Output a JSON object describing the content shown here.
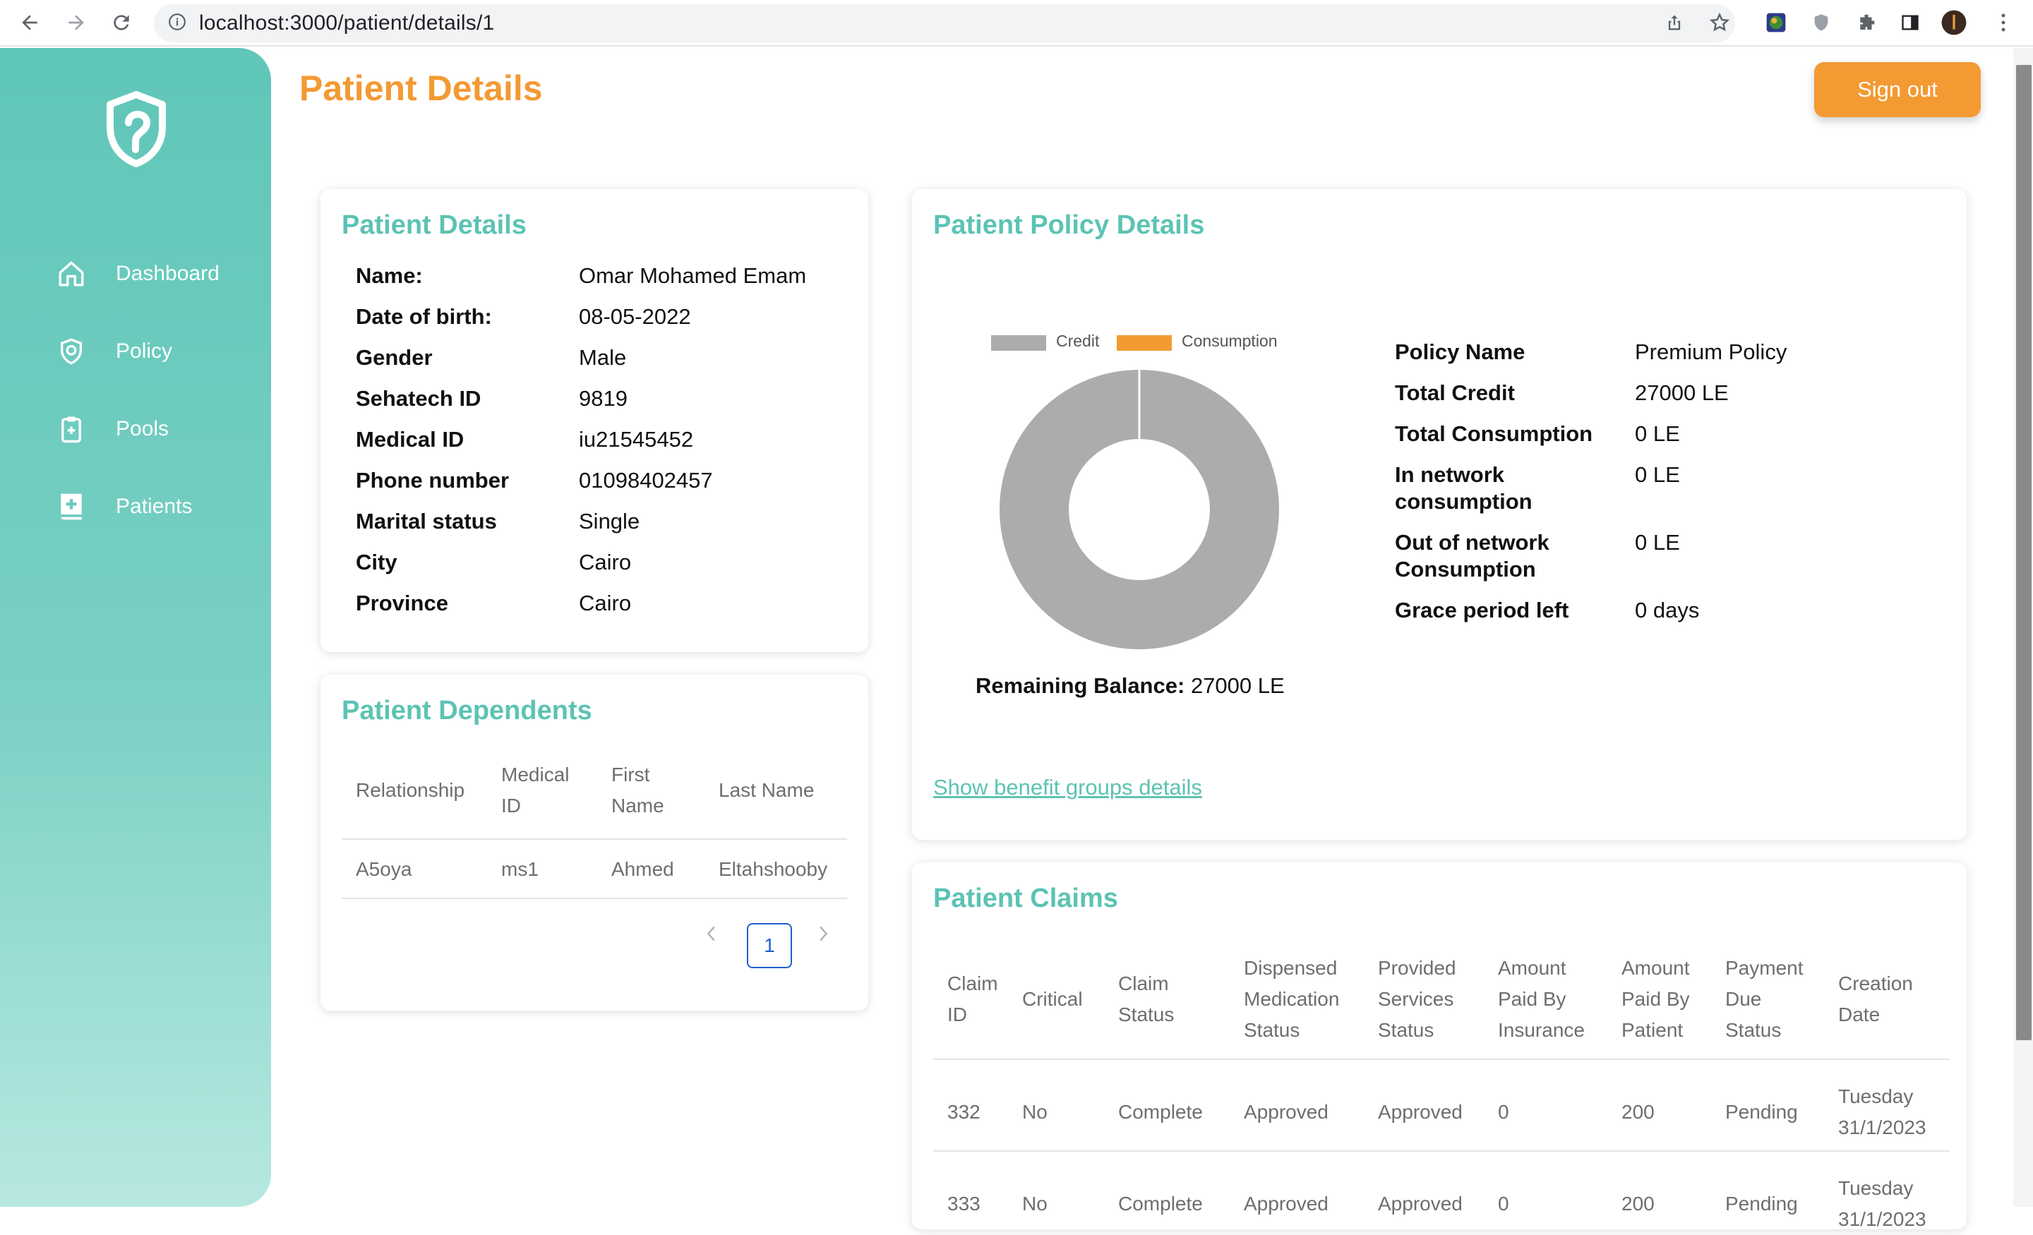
{
  "browser": {
    "url": "localhost:3000/patient/details/1"
  },
  "sidebar": {
    "items": [
      {
        "label": "Dashboard",
        "icon": "home-icon"
      },
      {
        "label": "Policy",
        "icon": "shield-icon"
      },
      {
        "label": "Pools",
        "icon": "clipboard-icon"
      },
      {
        "label": "Patients",
        "icon": "medical-book-icon"
      }
    ]
  },
  "header": {
    "title": "Patient Details",
    "signout_label": "Sign out"
  },
  "patient_details": {
    "title": "Patient Details",
    "fields": [
      {
        "label": "Name:",
        "value": "Omar Mohamed Emam"
      },
      {
        "label": "Date of birth:",
        "value": "08-05-2022"
      },
      {
        "label": "Gender",
        "value": "Male"
      },
      {
        "label": "Sehatech ID",
        "value": "9819"
      },
      {
        "label": "Medical ID",
        "value": "iu21545452"
      },
      {
        "label": "Phone number",
        "value": "01098402457"
      },
      {
        "label": "Marital status",
        "value": "Single"
      },
      {
        "label": "City",
        "value": "Cairo"
      },
      {
        "label": "Province",
        "value": "Cairo"
      }
    ]
  },
  "dependents": {
    "title": "Patient Dependents",
    "columns": [
      "Relationship",
      "Medical ID",
      "First Name",
      "Last Name"
    ],
    "rows": [
      [
        "A5oya",
        "ms1",
        "Ahmed",
        "Eltahshooby"
      ]
    ],
    "page": "1"
  },
  "policy": {
    "title": "Patient Policy Details",
    "legend": [
      {
        "label": "Credit",
        "color": "#acacac"
      },
      {
        "label": "Consumption",
        "color": "#f39a33"
      }
    ],
    "remaining_label": "Remaining Balance:",
    "remaining_value": "27000 LE",
    "fields": [
      {
        "label": "Policy Name",
        "value": "Premium Policy"
      },
      {
        "label": "Total Credit",
        "value": "27000 LE"
      },
      {
        "label": "Total Consumption",
        "value": "0 LE"
      },
      {
        "label": "In network consumption",
        "value": "0 LE"
      },
      {
        "label": "Out of network Consumption",
        "value": "0 LE"
      },
      {
        "label": "Grace period left",
        "value": "0 days"
      }
    ],
    "link": "Show benefit groups details"
  },
  "chart_data": {
    "type": "pie",
    "labels": [
      "Credit",
      "Consumption"
    ],
    "values": [
      27000,
      0
    ],
    "colors": [
      "#acacac",
      "#f39a33"
    ],
    "legend": "top"
  },
  "claims": {
    "title": "Patient Claims",
    "columns": [
      "Claim ID",
      "Critical",
      "Claim Status",
      "Dispensed Medication Status",
      "Provided Services Status",
      "Amount Paid By Insurance",
      "Amount Paid By Patient",
      "Payment Due Status",
      "Creation Date"
    ],
    "rows": [
      [
        "332",
        "No",
        "Complete",
        "Approved",
        "Approved",
        "0",
        "200",
        "Pending",
        "Tuesday 31/1/2023"
      ],
      [
        "333",
        "No",
        "Complete",
        "Approved",
        "Approved",
        "0",
        "200",
        "Pending",
        "Tuesday 31/1/2023"
      ]
    ]
  }
}
